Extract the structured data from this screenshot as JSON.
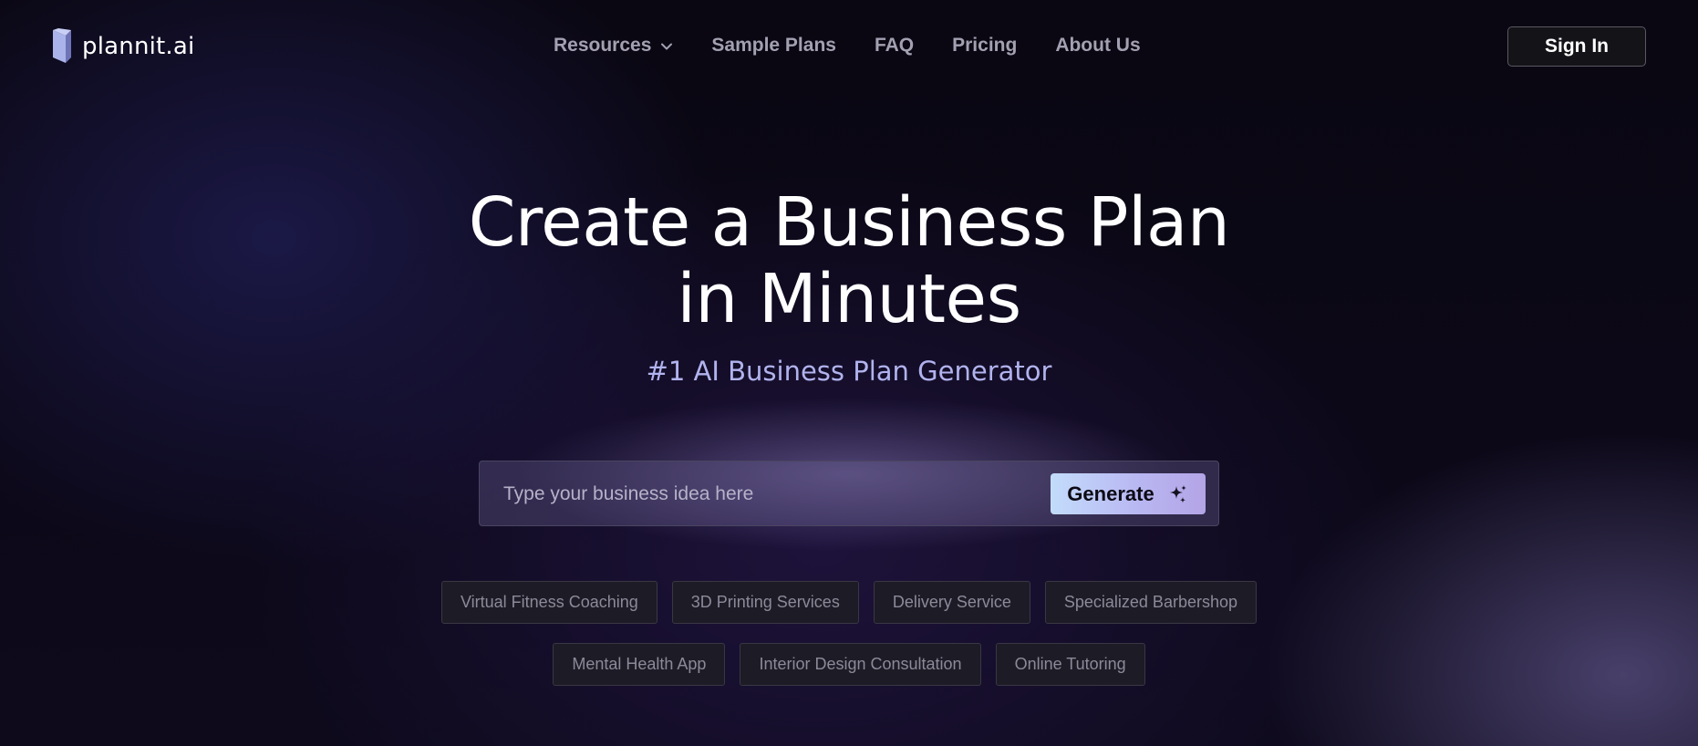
{
  "brand": {
    "name": "plannit.ai",
    "logo_icon": "plannit-logo-icon"
  },
  "nav": {
    "items": [
      {
        "label": "Resources",
        "icon": "chevron-down-icon"
      },
      {
        "label": "Sample Plans"
      },
      {
        "label": "FAQ"
      },
      {
        "label": "Pricing"
      },
      {
        "label": "About Us"
      }
    ]
  },
  "header": {
    "signin_label": "Sign In"
  },
  "hero": {
    "title_line1": "Create a Business Plan",
    "title_line2": "in Minutes",
    "subtitle": "#1 AI Business Plan Generator"
  },
  "search": {
    "value": "",
    "placeholder": "Type your business idea here",
    "button_label": "Generate",
    "button_icon": "sparkle-icon"
  },
  "suggestions": {
    "row1": [
      "Virtual Fitness Coaching",
      "3D Printing Services",
      "Delivery Service",
      "Specialized Barbershop"
    ],
    "row2": [
      "Mental Health App",
      "Interior Design Consultation",
      "Online Tutoring"
    ]
  },
  "colors": {
    "subtitle": "#b1b3ee",
    "generate_gradient_start": "#c3dcfb",
    "generate_gradient_end": "#b3a4e6",
    "nav_text": "#a3a0b2",
    "background": "#0c0818"
  }
}
